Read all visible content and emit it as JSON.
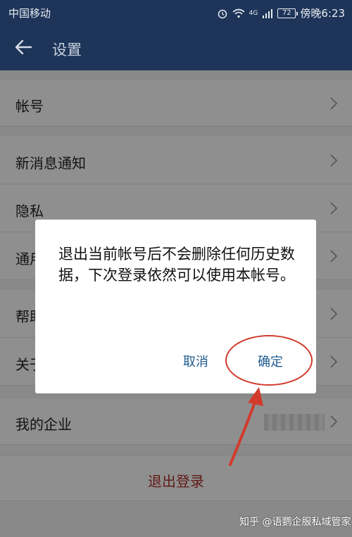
{
  "status_bar": {
    "carrier": "中国移动",
    "battery": "72",
    "time": "傍晚6:23",
    "network": "4G"
  },
  "app_bar": {
    "title": "设置"
  },
  "settings": {
    "items": [
      {
        "label": "帐号"
      },
      {
        "label": "新消息通知"
      },
      {
        "label": "隐私"
      },
      {
        "label": "通用"
      },
      {
        "label": "帮助与反馈"
      },
      {
        "label": "关于"
      },
      {
        "label": "我的企业"
      }
    ],
    "logout_label": "退出登录"
  },
  "dialog": {
    "message": "退出当前帐号后不会删除任何历史数据，下次登录依然可以使用本帐号。",
    "cancel_label": "取消",
    "confirm_label": "确定"
  },
  "watermark": "知乎 @语鹦企服私域管家",
  "colors": {
    "header_bg": "#1e3559",
    "logout_text": "#a53029",
    "dialog_button": "#1f5b8f",
    "annotation": "#d23a2c"
  }
}
